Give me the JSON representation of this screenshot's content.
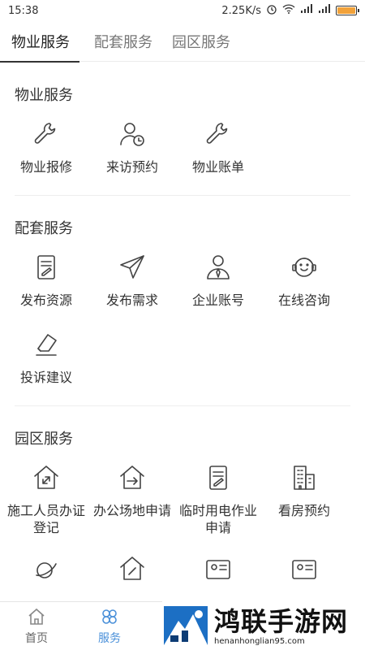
{
  "status_bar": {
    "time": "15:38",
    "speed": "2.25K/s"
  },
  "tabs": [
    {
      "label": "物业服务",
      "active": true
    },
    {
      "label": "配套服务",
      "active": false
    },
    {
      "label": "园区服务",
      "active": false
    }
  ],
  "sections": {
    "property": {
      "title": "物业服务",
      "items": [
        {
          "label": "物业报修",
          "icon": "wrench-icon"
        },
        {
          "label": "来访预约",
          "icon": "visitor-clock-icon"
        },
        {
          "label": "物业账单",
          "icon": "wrench-icon"
        }
      ]
    },
    "supporting": {
      "title": "配套服务",
      "items": [
        {
          "label": "发布资源",
          "icon": "document-edit-icon"
        },
        {
          "label": "发布需求",
          "icon": "paper-plane-icon"
        },
        {
          "label": "企业账号",
          "icon": "businessman-icon"
        },
        {
          "label": "在线咨询",
          "icon": "headset-icon"
        },
        {
          "label": "投诉建议",
          "icon": "eraser-icon"
        }
      ]
    },
    "park": {
      "title": "园区服务",
      "items": [
        {
          "label": "施工人员办证登记",
          "icon": "house-expand-icon"
        },
        {
          "label": "办公场地申请",
          "icon": "house-arrow-icon"
        },
        {
          "label": "临时用电作业申请",
          "icon": "document-edit-icon"
        },
        {
          "label": "看房预约",
          "icon": "building-icon"
        }
      ]
    }
  },
  "bottom_nav": [
    {
      "label": "首页",
      "icon": "home-icon",
      "active": false
    },
    {
      "label": "服务",
      "icon": "clover-icon",
      "active": true
    }
  ],
  "watermark": {
    "title": "鸿联手游网",
    "url": "henanhonglian95.com"
  },
  "colors": {
    "accent": "#4a90d9",
    "battery": "#f2a23a"
  }
}
